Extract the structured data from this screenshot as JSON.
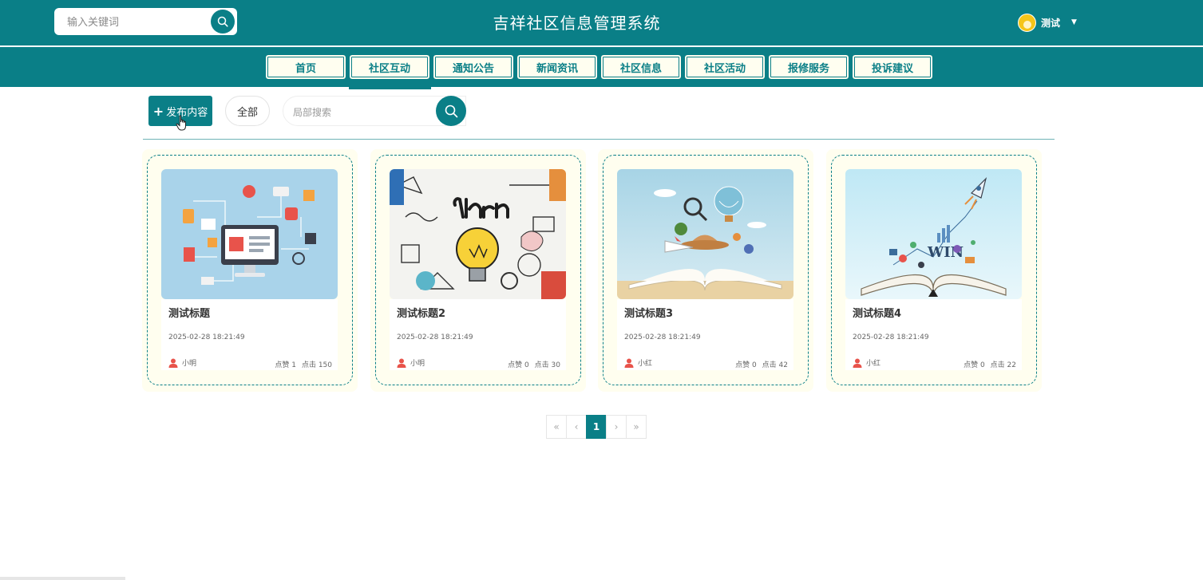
{
  "header": {
    "search_placeholder": "输入关键词",
    "title": "吉祥社区信息管理系统",
    "user_name": "测试"
  },
  "nav": {
    "items": [
      "首页",
      "社区互动",
      "通知公告",
      "新闻资讯",
      "社区信息",
      "社区活动",
      "报修服务",
      "投诉建议"
    ],
    "active": "社区互动"
  },
  "toolbar": {
    "publish_label": "发布内容",
    "filter_label": "全部",
    "search_placeholder": "局部搜索"
  },
  "cards": [
    {
      "title": "测试标题",
      "date": "2025-02-28 18:21:49",
      "author": "小明",
      "likes": "点赞 1",
      "clicks": "点击 150",
      "image": "network-illustration"
    },
    {
      "title": "测试标题2",
      "date": "2025-02-28 18:21:49",
      "author": "小明",
      "likes": "点赞 0",
      "clicks": "点击 30",
      "image": "learn-doodle"
    },
    {
      "title": "测试标题3",
      "date": "2025-02-28 18:21:49",
      "author": "小红",
      "likes": "点赞 0",
      "clicks": "点击 42",
      "image": "book-travel"
    },
    {
      "title": "测试标题4",
      "date": "2025-02-28 18:21:49",
      "author": "小红",
      "likes": "点赞 0",
      "clicks": "点击 22",
      "image": "book-win"
    }
  ],
  "pagination": {
    "first": "«",
    "prev": "‹",
    "current": "1",
    "next": "›",
    "last": "»"
  },
  "colors": {
    "primary": "#0a7f87",
    "card_bg": "#fffeef",
    "author_icon": "#e8534b"
  }
}
